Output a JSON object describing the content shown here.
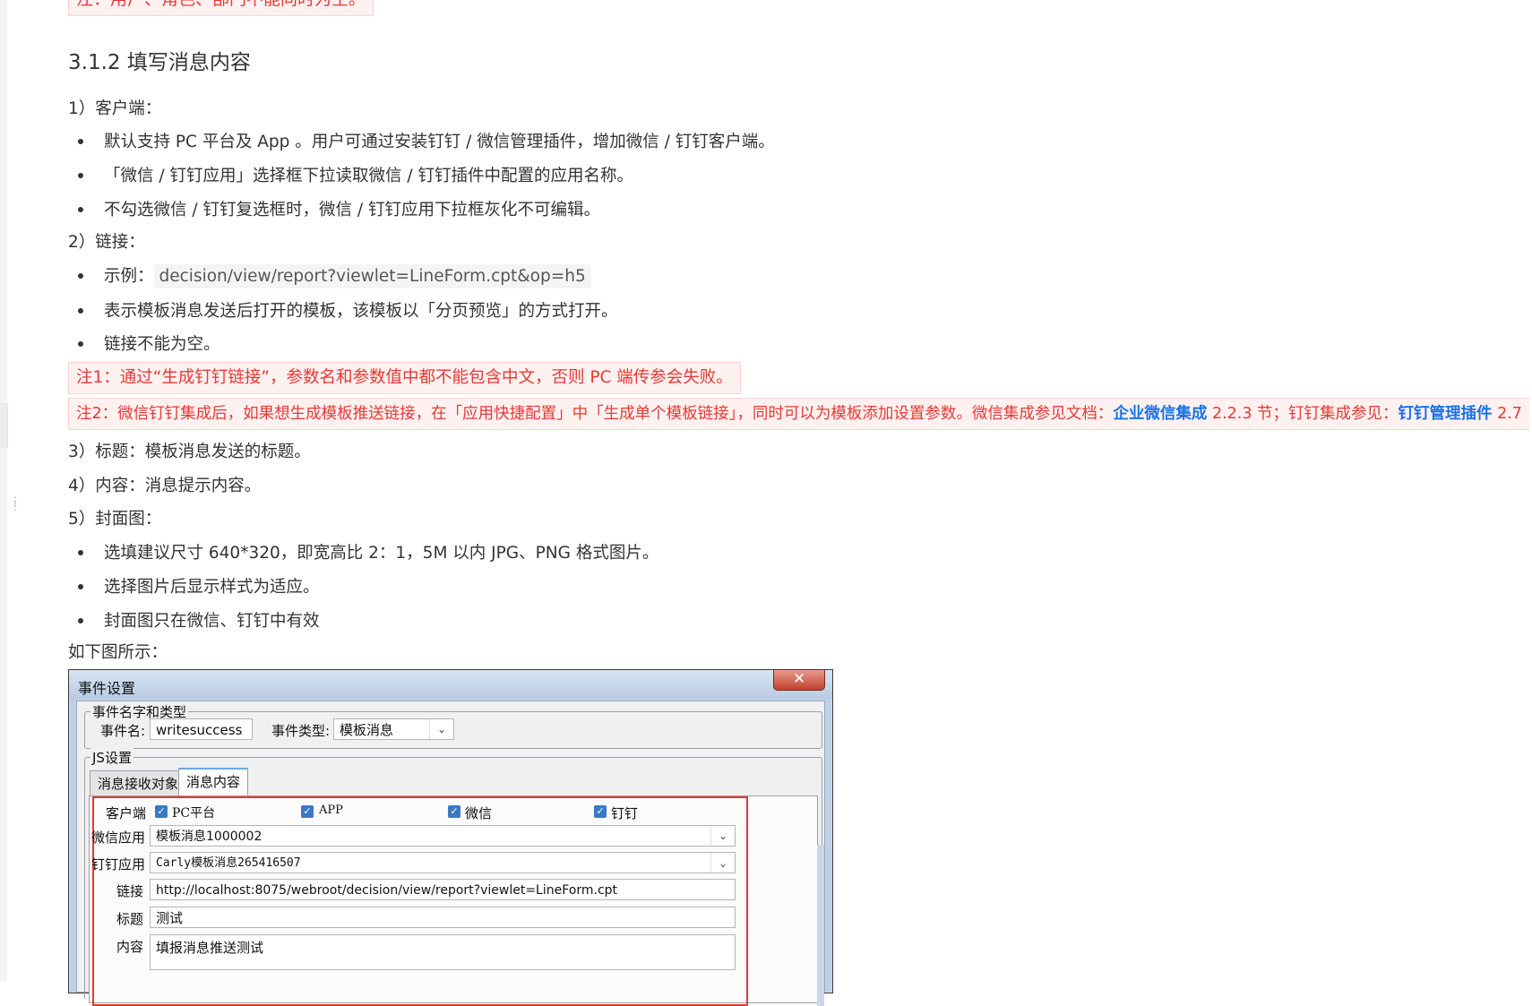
{
  "doc": {
    "top_note": "注：用户、角色、部门不能同时为空。",
    "heading": "3.1.2 填写消息内容",
    "sec1_title": "1）客户端：",
    "sec1_items": [
      "默认支持 PC 平台及 App 。用户可通过安装钉钉 / 微信管理插件，增加微信 / 钉钉客户端。",
      "「微信 / 钉钉应用」选择框下拉读取微信 / 钉钉插件中配置的应用名称。",
      "不勾选微信 / 钉钉复选框时，微信 / 钉钉应用下拉框灰化不可编辑。"
    ],
    "sec2_title": "2）链接：",
    "sec2_example_label": "示例：",
    "sec2_example_code": "decision/view/report?viewlet=LineForm.cpt&op=h5",
    "sec2_items": [
      "表示模板消息发送后打开的模板，该模板以「分页预览」的方式打开。",
      "链接不能为空。"
    ],
    "note1": "注1：通过“生成钉钉链接”，参数名和参数值中都不能包含中文，否则 PC 端传参会失败。",
    "note2_a": "注2：微信钉钉集成后，如果想生成模板推送链接，在「应用快捷配置」中「生成单个模板链接」，同时可以为模板添加设置参数。微信集成参见文档：",
    "note2_link1": "企业微信集成",
    "note2_b": " 2.2.3 节；钉钉集成参见：",
    "note2_link2": "钉钉管理插件",
    "note2_c": " 2.7",
    "sec3": "3）标题：模板消息发送的标题。",
    "sec4": "4）内容：消息提示内容。",
    "sec5_title": "5）封面图：",
    "sec5_items": [
      "选填建议尺寸 640*320，即宽高比 2：1，5M 以内 JPG、PNG 格式图片。",
      "选择图片后显示样式为适应。",
      "封面图只在微信、钉钉中有效"
    ],
    "fig_intro": "如下图所示："
  },
  "dialog": {
    "title": "事件设置",
    "close": "✕",
    "group1": "事件名字和类型",
    "event_name_label": "事件名:",
    "event_name_value": "writesuccess",
    "event_type_label": "事件类型:",
    "event_type_value": "模板消息",
    "group2": "JS设置",
    "tab1": "消息接收对象",
    "tab2": "消息内容",
    "client_label": "客户端",
    "cb_pc": "PC平台",
    "cb_app": "APP",
    "cb_wechat": "微信",
    "cb_dingtalk": "钉钉",
    "wechat_app_label": "微信应用",
    "wechat_app_value": "模板消息1000002",
    "ding_app_label": "钉钉应用",
    "ding_app_value": "Carly模板消息265416507",
    "link_label": "链接",
    "link_value": "http://localhost:8075/webroot/decision/view/report?viewlet=LineForm.cpt",
    "title_label": "标题",
    "title_value": "测试",
    "content_label": "内容",
    "content_value": "填报消息推送测试"
  }
}
